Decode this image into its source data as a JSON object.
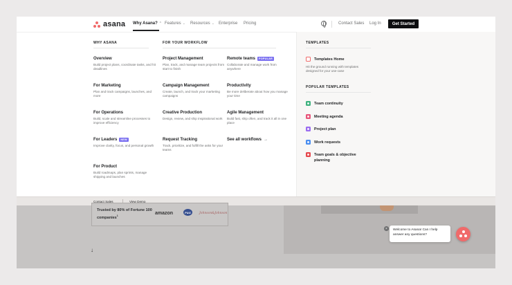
{
  "brand": {
    "name": "asana",
    "accent": "#f06a6a"
  },
  "nav": {
    "items": [
      {
        "label": "Why Asana?",
        "active": true,
        "dropdown": true
      },
      {
        "label": "Features",
        "dropdown": true
      },
      {
        "label": "Resources",
        "dropdown": true
      },
      {
        "label": "Enterprise"
      },
      {
        "label": "Pricing"
      }
    ],
    "contact": "Contact Sales",
    "login": "Log In",
    "cta": "Get Started"
  },
  "menu": {
    "why_label": "WHY ASANA",
    "workflow_label": "FOR YOUR WORKFLOW",
    "templates_label": "TEMPLATES",
    "popular_label": "POPULAR TEMPLATES",
    "why": [
      {
        "title": "Overview",
        "desc": "Build project plans, coordinate tasks, and hit deadlines"
      },
      {
        "title": "For Marketing",
        "desc": "Plan and track campaigns, launches, and more"
      },
      {
        "title": "For Operations",
        "desc": "Build, scale and streamline processes to improve efficiency"
      },
      {
        "title": "For Leaders",
        "badge": "NEW",
        "desc": "Improve clarity, focus, and personal growth"
      },
      {
        "title": "For Product",
        "desc": "Build roadmaps, plan sprints, manage shipping and launches"
      }
    ],
    "workflow_col1": [
      {
        "title": "Project Management",
        "desc": "Plan, track, and manage team projects from start to finish"
      },
      {
        "title": "Campaign Management",
        "desc": "Create, launch, and track your marketing campaigns"
      },
      {
        "title": "Creative Production",
        "desc": "Design, review, and ship inspirational work"
      },
      {
        "title": "Request Tracking",
        "desc": "Track, prioritize, and fulfill the asks for your teams"
      }
    ],
    "workflow_col2": [
      {
        "title": "Remote teams",
        "badge": "POPULAR",
        "desc": "Collaborate and manage work from anywhere"
      },
      {
        "title": "Productivity",
        "desc": "Be more deliberate about how you manage your time"
      },
      {
        "title": "Agile Management",
        "desc": "Build fast, ship often, and track it all in one place"
      },
      {
        "title": "See all workflows",
        "arrow": "→"
      }
    ],
    "templates_home": {
      "title": "Templates Home",
      "desc": "Hit the ground running with templates designed for your use-case"
    },
    "popular": [
      {
        "label": "Team continuity",
        "color": "#3fb27f"
      },
      {
        "label": "Meeting agenda",
        "color": "#e8557a"
      },
      {
        "label": "Project plan",
        "color": "#9b6cf0"
      },
      {
        "label": "Work requests",
        "color": "#4a8ef0"
      },
      {
        "label": "Team goals & objective planning",
        "color": "#e5484d"
      }
    ]
  },
  "strip": {
    "contact": "Contact Sales",
    "demo": "View Demo"
  },
  "background": {
    "trusted": "Trusted by 80% of Fortune 100 companies",
    "trusted_sup": "1",
    "logos": [
      "amazon",
      "P&G",
      "Johnson&Johnson"
    ]
  },
  "chat": {
    "message": "Welcome to Asana! Can I help answer any questions?",
    "close": "×"
  }
}
